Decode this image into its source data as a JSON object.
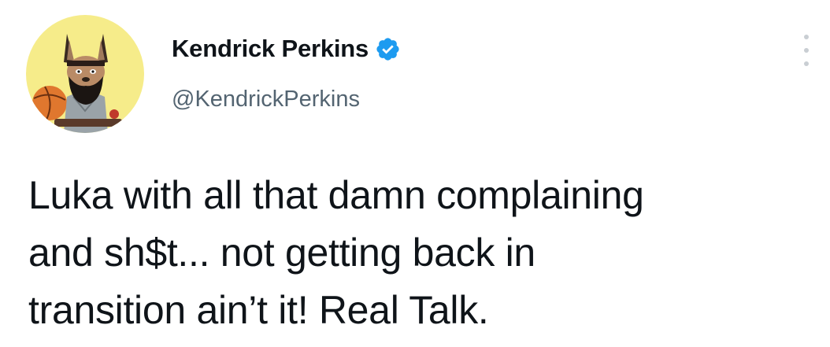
{
  "author": {
    "display_name": "Kendrick Perkins",
    "handle": "@KendrickPerkins",
    "verified": true,
    "avatar_icon": "cartoon-avatar-with-basketball",
    "avatar_background": "#f6ec8a"
  },
  "tweet": {
    "lines": [
      "Luka with all that damn complaining",
      "and sh$t... not getting back in",
      "transition ain’t it! Real Talk."
    ]
  },
  "actions": {
    "more_icon": "more-vertical-icon"
  },
  "colors": {
    "verified_badge": "#1d9bf0",
    "text_primary": "#0f1419",
    "text_secondary": "#536471"
  }
}
